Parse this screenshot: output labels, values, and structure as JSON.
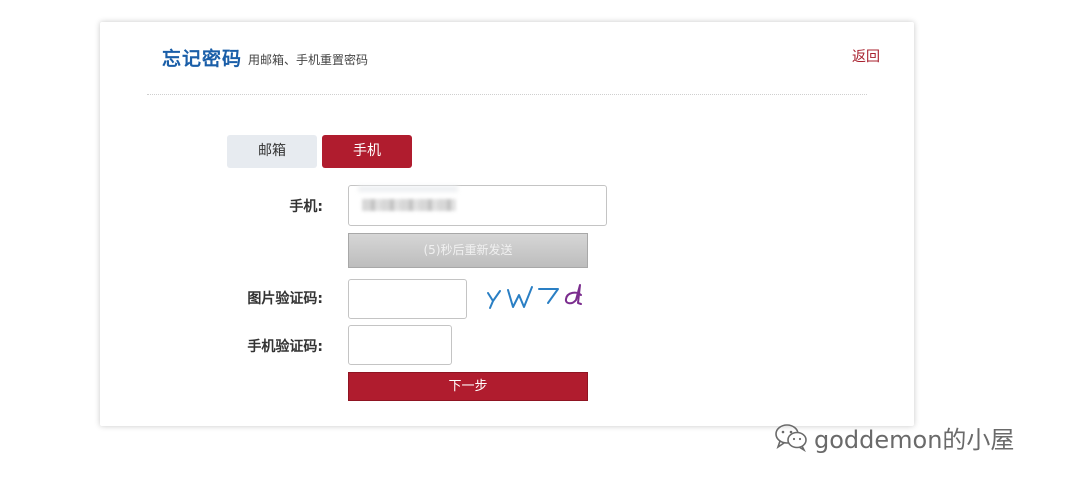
{
  "header": {
    "title": "忘记密码",
    "subtitle": "用邮箱、手机重置密码",
    "back_label": "返回"
  },
  "tabs": [
    {
      "label": "邮箱",
      "active": false
    },
    {
      "label": "手机",
      "active": true
    }
  ],
  "form": {
    "phone_label": "手机:",
    "phone_value": "",
    "resend_label": "(5)秒后重新发送",
    "image_code_label": "图片验证码:",
    "image_code_value": "",
    "captcha_text": "YW7d",
    "sms_code_label": "手机验证码:",
    "sms_code_value": "",
    "next_label": "下一步"
  },
  "watermark": {
    "text": "goddemon的小屋",
    "icon": "wechat-icon"
  },
  "colors": {
    "primary_red": "#b01c2e",
    "title_blue": "#1a5ea8",
    "captcha_blue": "#2a7fc4",
    "captcha_purple": "#7b2d8e"
  }
}
